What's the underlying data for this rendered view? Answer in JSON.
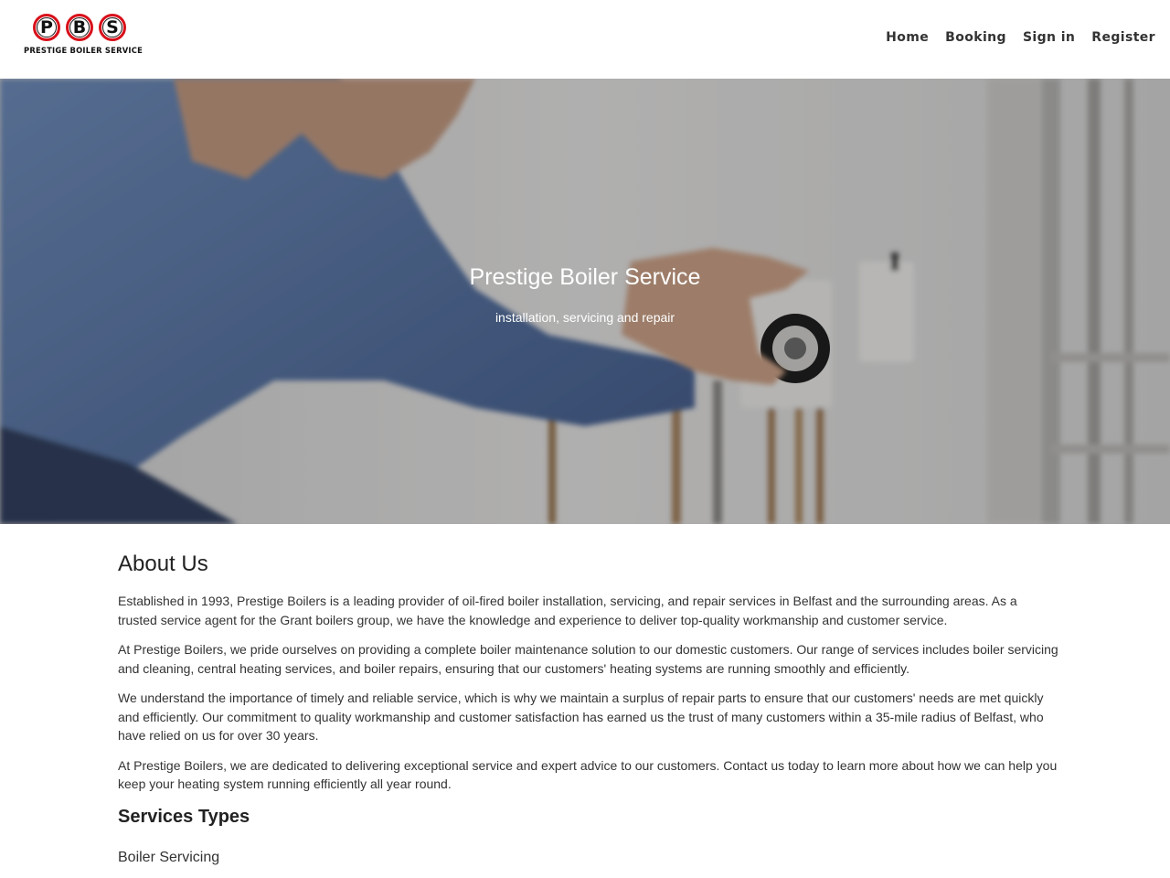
{
  "logo": {
    "letters": [
      "P",
      "B",
      "S"
    ],
    "text": "PRESTIGE BOILER SERVICE"
  },
  "nav": {
    "items": [
      "Home",
      "Booking",
      "Sign in",
      "Register"
    ]
  },
  "hero": {
    "title": "Prestige Boiler Service",
    "subtitle": "installation, servicing and repair"
  },
  "about": {
    "title": "About Us",
    "paragraphs": [
      "Established in 1993, Prestige Boilers is a leading provider of oil-fired boiler installation, servicing, and repair services in Belfast and the surrounding areas. As a trusted service agent for the Grant boilers group, we have the knowledge and experience to deliver top-quality workmanship and customer service.",
      "At Prestige Boilers, we pride ourselves on providing a complete boiler maintenance solution to our domestic customers. Our range of services includes boiler servicing and cleaning, central heating services, and boiler repairs, ensuring that our customers' heating systems are running smoothly and efficiently.",
      "We understand the importance of timely and reliable service, which is why we maintain a surplus of repair parts to ensure that our customers' needs are met quickly and efficiently. Our commitment to quality workmanship and customer satisfaction has earned us the trust of many customers within a 35-mile radius of Belfast, who have relied on us for over 30 years.",
      "At Prestige Boilers, we are dedicated to delivering exceptional service and expert advice to our customers. Contact us today to learn more about how we can help you keep your heating system running efficiently all year round."
    ]
  },
  "services": {
    "title": "Services Types",
    "items": [
      "Boiler Servicing"
    ]
  }
}
